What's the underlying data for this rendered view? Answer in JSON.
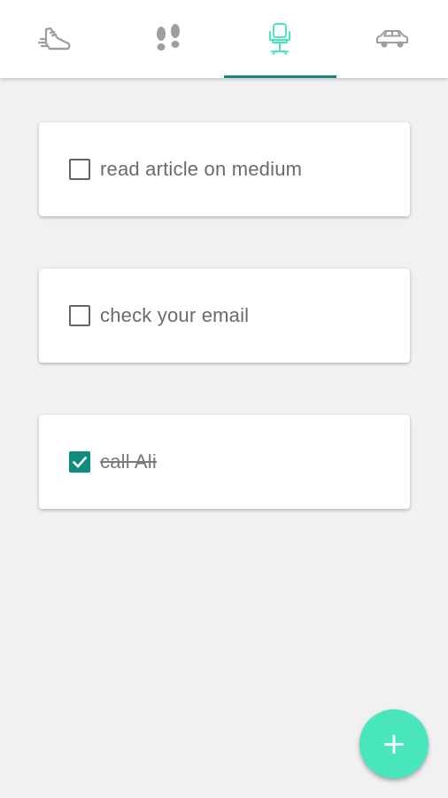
{
  "tabs": [
    {
      "icon": "running-shoe-icon",
      "active": false
    },
    {
      "icon": "footprints-icon",
      "active": false
    },
    {
      "icon": "office-chair-icon",
      "active": true
    },
    {
      "icon": "car-icon",
      "active": false
    }
  ],
  "tasks": [
    {
      "label": "read article on medium",
      "checked": false
    },
    {
      "label": "check your email",
      "checked": false
    },
    {
      "label": "call Ali",
      "checked": true
    }
  ],
  "fab": {
    "label": "+",
    "icon": "plus-icon"
  },
  "colors": {
    "accent": "#49e5bd",
    "indicator": "#17897b",
    "checkbox_checked": "#0f8c7e",
    "icon_inactive": "#9e9e9e",
    "background": "#f1f1f1"
  }
}
